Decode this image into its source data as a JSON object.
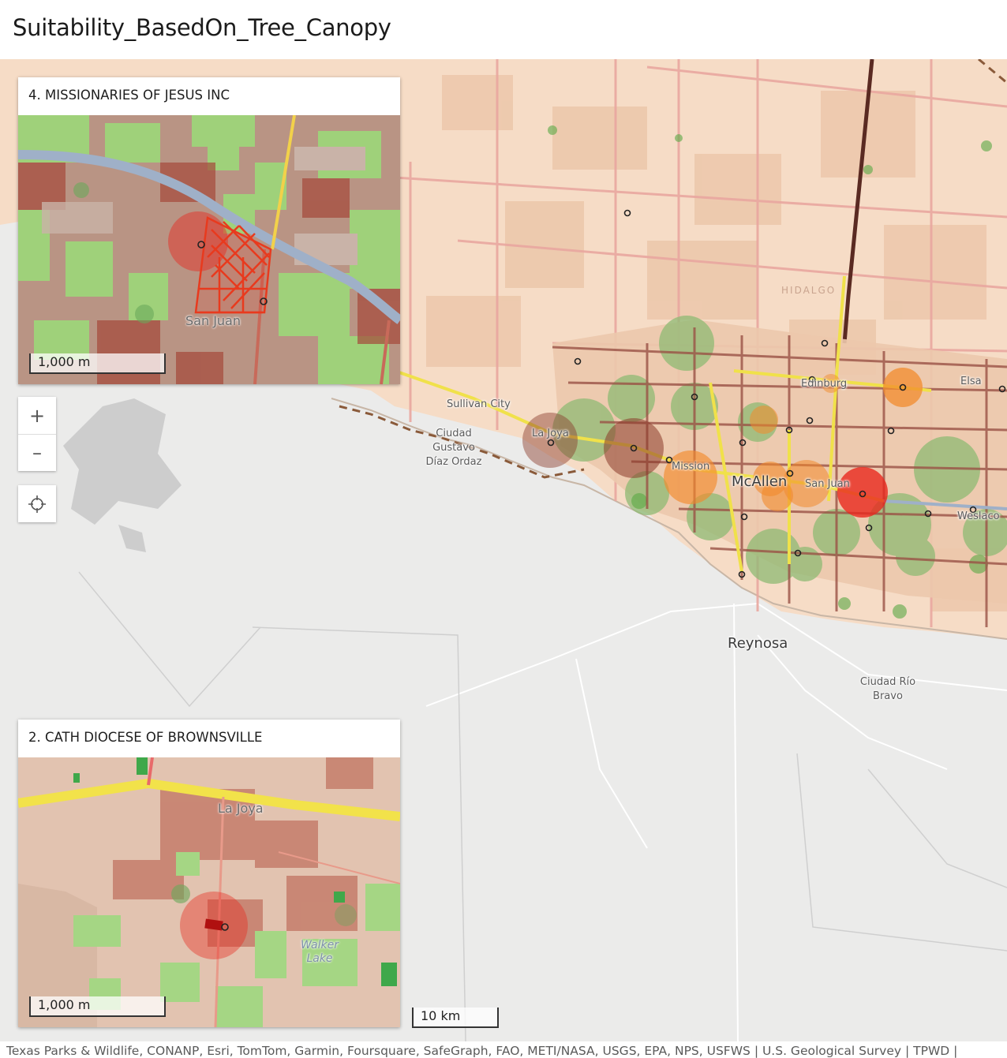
{
  "title": "Suitability_BasedOn_Tree_Canopy",
  "map": {
    "labels": {
      "hidalgo": "HIDALGO",
      "edinburg": "Edinburg",
      "elsa": "Elsa",
      "sullivan_city": "Sullivan City",
      "ciudad_gustavo_diaz_ordaz": [
        "Ciudad",
        "Gustavo",
        "Díaz Ordaz"
      ],
      "la_joya": "La Joya",
      "mission": "Mission",
      "mcallen": "McAllen",
      "san_juan": "San Juan",
      "weslaco": "Weslaco",
      "reynosa": "Reynosa",
      "ciudad_rio_bravo": [
        "Ciudad Río",
        "Bravo"
      ]
    },
    "scale_label": "10 km"
  },
  "insets": [
    {
      "title": "4. MISSIONARIES OF JESUS INC",
      "place_label": "San Juan",
      "scale_label": "1,000 m"
    },
    {
      "title": "2. CATH DIOCESE OF BROWNSVILLE",
      "place_label": "La Joya",
      "water_label": "Walker Lake",
      "water_label_lines": [
        "Walker",
        "Lake"
      ],
      "scale_label": "1,000 m"
    }
  ],
  "controls": {
    "zoom_in": "+",
    "zoom_out": "–",
    "locate_icon": "crosshair-icon"
  },
  "colors": {
    "land_light": "#f6dcc6",
    "land_dark": "#ecc0a2",
    "mexico_gray": "#ebebea",
    "canopy_green": "#7bbd5d",
    "suitability_high": "#e8281e",
    "suitability_mid": "#f28b2c",
    "suitability_low": "#8a3a2a",
    "highway": "#f2e24a",
    "river": "#9fb0c8"
  },
  "attribution": "Texas Parks & Wildlife, CONANP, Esri, TomTom, Garmin, Foursquare, SafeGraph, FAO, METI/NASA, USGS, EPA, NPS, USFWS | U.S. Geological Survey | TPWD |"
}
